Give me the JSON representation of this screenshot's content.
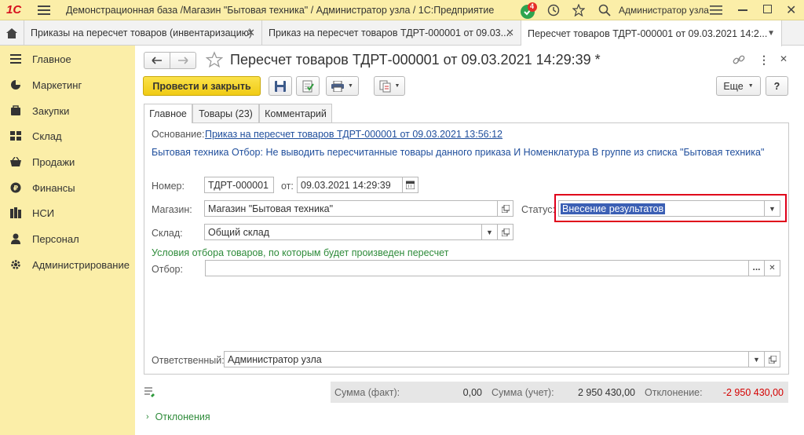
{
  "app": {
    "title": "Демонстрационная база /Магазин \"Бытовая техника\" / Администратор узла / 1С:Предприятие",
    "notification_count": "4",
    "user": "Администратор узла",
    "logo": "1С"
  },
  "tabs": [
    {
      "label": "Приказы на пересчет товаров (инвентаризацию)"
    },
    {
      "label": "Приказ на пересчет товаров ТДРТ-000001 от 09.03...."
    },
    {
      "label": "Пересчет товаров ТДРТ-000001 от 09.03.2021 14:2..."
    }
  ],
  "sidebar": {
    "items": [
      {
        "label": "Главное",
        "icon": "menu-icon"
      },
      {
        "label": "Маркетинг",
        "icon": "pie-chart-icon"
      },
      {
        "label": "Закупки",
        "icon": "purchases-icon"
      },
      {
        "label": "Склад",
        "icon": "warehouse-icon"
      },
      {
        "label": "Продажи",
        "icon": "basket-icon"
      },
      {
        "label": "Финансы",
        "icon": "ruble-coin-icon"
      },
      {
        "label": "НСИ",
        "icon": "books-icon"
      },
      {
        "label": "Персонал",
        "icon": "person-icon"
      },
      {
        "label": "Администрирование",
        "icon": "gear-icon"
      }
    ]
  },
  "document": {
    "title": "Пересчет товаров ТДРТ-000001 от 09.03.2021 14:29:39 *",
    "post_close_label": "Провести и закрыть",
    "more_label": "Еще",
    "help_label": "?",
    "form_tabs": [
      "Главное",
      "Товары (23)",
      "Комментарий"
    ],
    "basis_label": "Основание:",
    "basis_link": "Приказ на пересчет товаров ТДРТ-000001 от 09.03.2021 13:56:12",
    "filter_description": "Бытовая техника  Отбор: Не выводить пересчитанные товары данного приказа И Номенклатура В группе из списка \"Бытовая техника\"",
    "number_label": "Номер:",
    "number_value": "ТДРТ-000001",
    "date_label": "от:",
    "date_value": "09.03.2021 14:29:39",
    "store_label": "Магазин:",
    "store_value": "Магазин \"Бытовая техника\"",
    "status_label": "Статус:",
    "status_value": "Внесение результатов",
    "warehouse_label": "Склад:",
    "warehouse_value": "Общий склад",
    "conditions_heading": "Условия отбора товаров, по которым будет произведен пересчет",
    "filter_label": "Отбор:",
    "filter_value": "",
    "filter_more": "...",
    "responsible_label": "Ответственный:",
    "responsible_value": "Администратор узла",
    "sum_fact_label": "Сумма (факт):",
    "sum_fact_value": "0,00",
    "sum_account_label": "Сумма (учет):",
    "sum_account_value": "2 950 430,00",
    "deviation_label": "Отклонение:",
    "deviation_value": "-2 950 430,00",
    "deviations_link": "Отклонения"
  },
  "colors": {
    "accent_yellow": "#fbeea8",
    "post_button": "#f5d31d",
    "highlight_red": "#e0001a",
    "link_blue": "#1f4e9c",
    "green_text": "#2e8b3a",
    "negative_red": "#d40000"
  }
}
